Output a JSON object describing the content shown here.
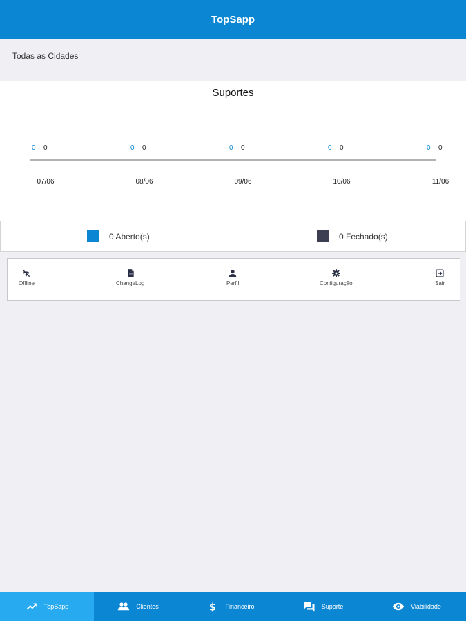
{
  "header": {
    "title": "TopSapp"
  },
  "filter": {
    "city": "Todas as Cidades"
  },
  "colors": {
    "primary": "#0a86d3",
    "active_tab": "#28aaf0",
    "aberto": "#0a86d3",
    "fechado": "#3c3f52"
  },
  "chart_data": {
    "type": "line",
    "title": "Suportes",
    "categories": [
      "07/06",
      "08/06",
      "09/06",
      "10/06",
      "11/06"
    ],
    "series": [
      {
        "name": "Aberto(s)",
        "values": [
          0,
          0,
          0,
          0,
          0
        ]
      },
      {
        "name": "Fechado(s)",
        "values": [
          0,
          0,
          0,
          0,
          0
        ]
      }
    ]
  },
  "legend": {
    "aberto": "0 Aberto(s)",
    "fechado": "0 Fechado(s)"
  },
  "actions": [
    {
      "label": "Offline",
      "icon": "wifi-off-icon"
    },
    {
      "label": "ChangeLog",
      "icon": "document-icon"
    },
    {
      "label": "Perfil",
      "icon": "person-icon"
    },
    {
      "label": "Configuração",
      "icon": "gear-icon"
    },
    {
      "label": "Sair",
      "icon": "exit-icon"
    }
  ],
  "tabs": [
    {
      "label": "TopSapp",
      "icon": "trending-up-icon",
      "active": true
    },
    {
      "label": "Clientes",
      "icon": "people-icon",
      "active": false
    },
    {
      "label": "Financeiro",
      "icon": "dollar-icon",
      "active": false
    },
    {
      "label": "Suporte",
      "icon": "chat-icon",
      "active": false
    },
    {
      "label": "Viabilidade",
      "icon": "eye-icon",
      "active": false
    }
  ]
}
